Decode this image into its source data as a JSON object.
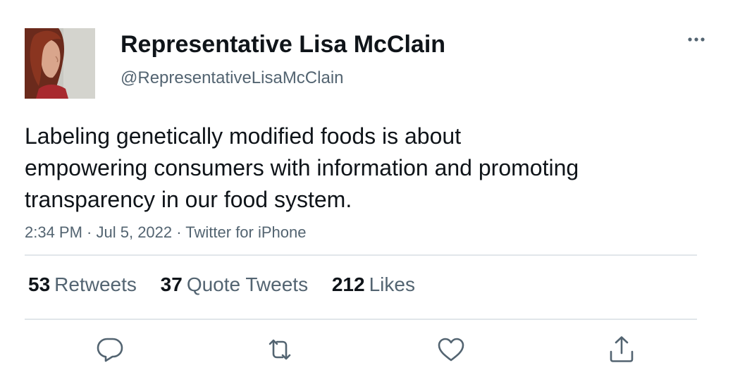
{
  "author": {
    "display_name": "Representative Lisa McClain",
    "handle": "@RepresentativeLisaMcClain",
    "avatar_icon": "profile-photo"
  },
  "tweet": {
    "text_lines": [
      "Labeling genetically modified foods is about",
      "empowering consumers with information and promoting",
      "transparency in our food system."
    ],
    "time": "2:34 PM",
    "date": "Jul 5, 2022",
    "source": "Twitter for iPhone",
    "separator": " · "
  },
  "stats": {
    "retweets": {
      "count": "53",
      "label": "Retweets"
    },
    "quote_tweets": {
      "count": "37",
      "label": "Quote Tweets"
    },
    "likes": {
      "count": "212",
      "label": "Likes"
    }
  },
  "actions": {
    "reply_icon": "reply-icon",
    "retweet_icon": "retweet-icon",
    "like_icon": "heart-icon",
    "share_icon": "share-icon",
    "more_icon": "more-dots-icon"
  },
  "colors": {
    "text_primary": "#0f1419",
    "text_secondary": "#536471",
    "divider": "#e1e6ea",
    "icon": "#536471"
  }
}
